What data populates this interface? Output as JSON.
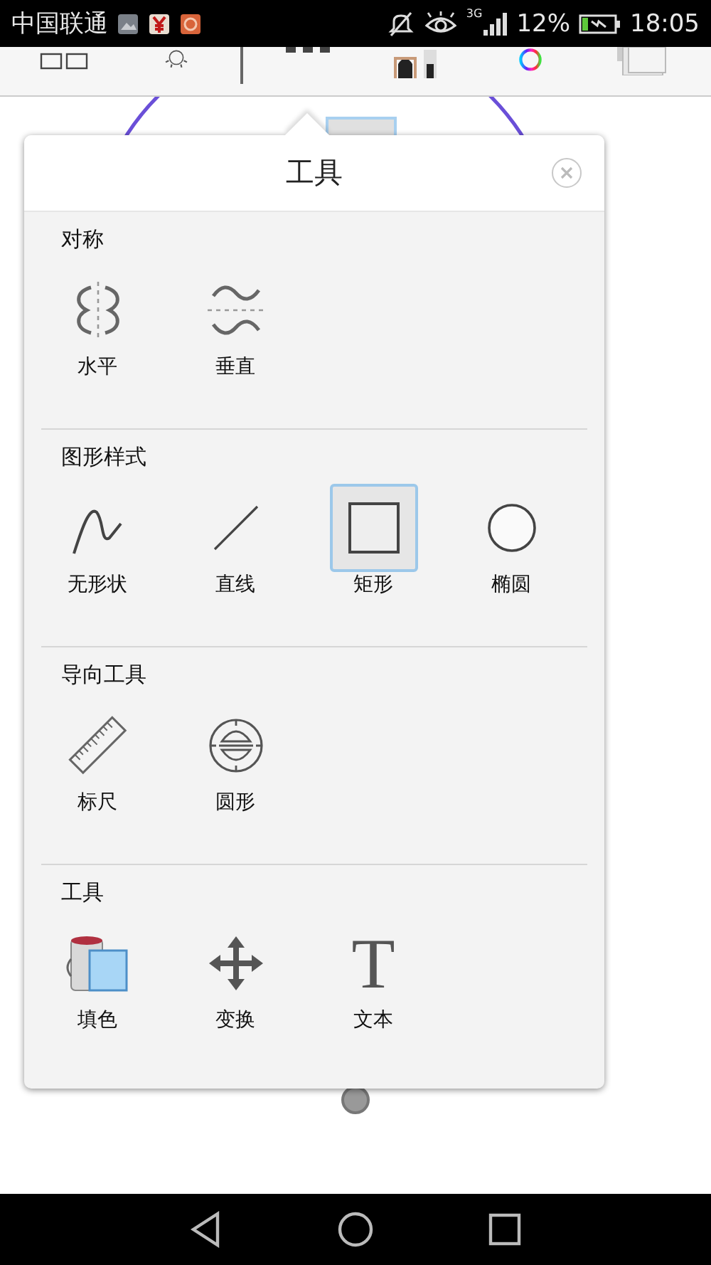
{
  "status_bar": {
    "carrier": "中国联通",
    "network": "3G",
    "battery": "12%",
    "time": "18:05"
  },
  "popover": {
    "title": "工具",
    "sections": [
      {
        "title": "对称",
        "tools": [
          {
            "label": "水平",
            "selected": false
          },
          {
            "label": "垂直",
            "selected": false
          }
        ]
      },
      {
        "title": "图形样式",
        "tools": [
          {
            "label": "无形状",
            "selected": false
          },
          {
            "label": "直线",
            "selected": false
          },
          {
            "label": "矩形",
            "selected": true
          },
          {
            "label": "椭圆",
            "selected": false
          }
        ]
      },
      {
        "title": "导向工具",
        "tools": [
          {
            "label": "标尺",
            "selected": false
          },
          {
            "label": "圆形",
            "selected": false
          }
        ]
      },
      {
        "title": "工具",
        "tools": [
          {
            "label": "填色",
            "selected": false
          },
          {
            "label": "变换",
            "selected": false
          },
          {
            "label": "文本",
            "selected": false,
            "glyph": "T"
          }
        ]
      }
    ]
  }
}
